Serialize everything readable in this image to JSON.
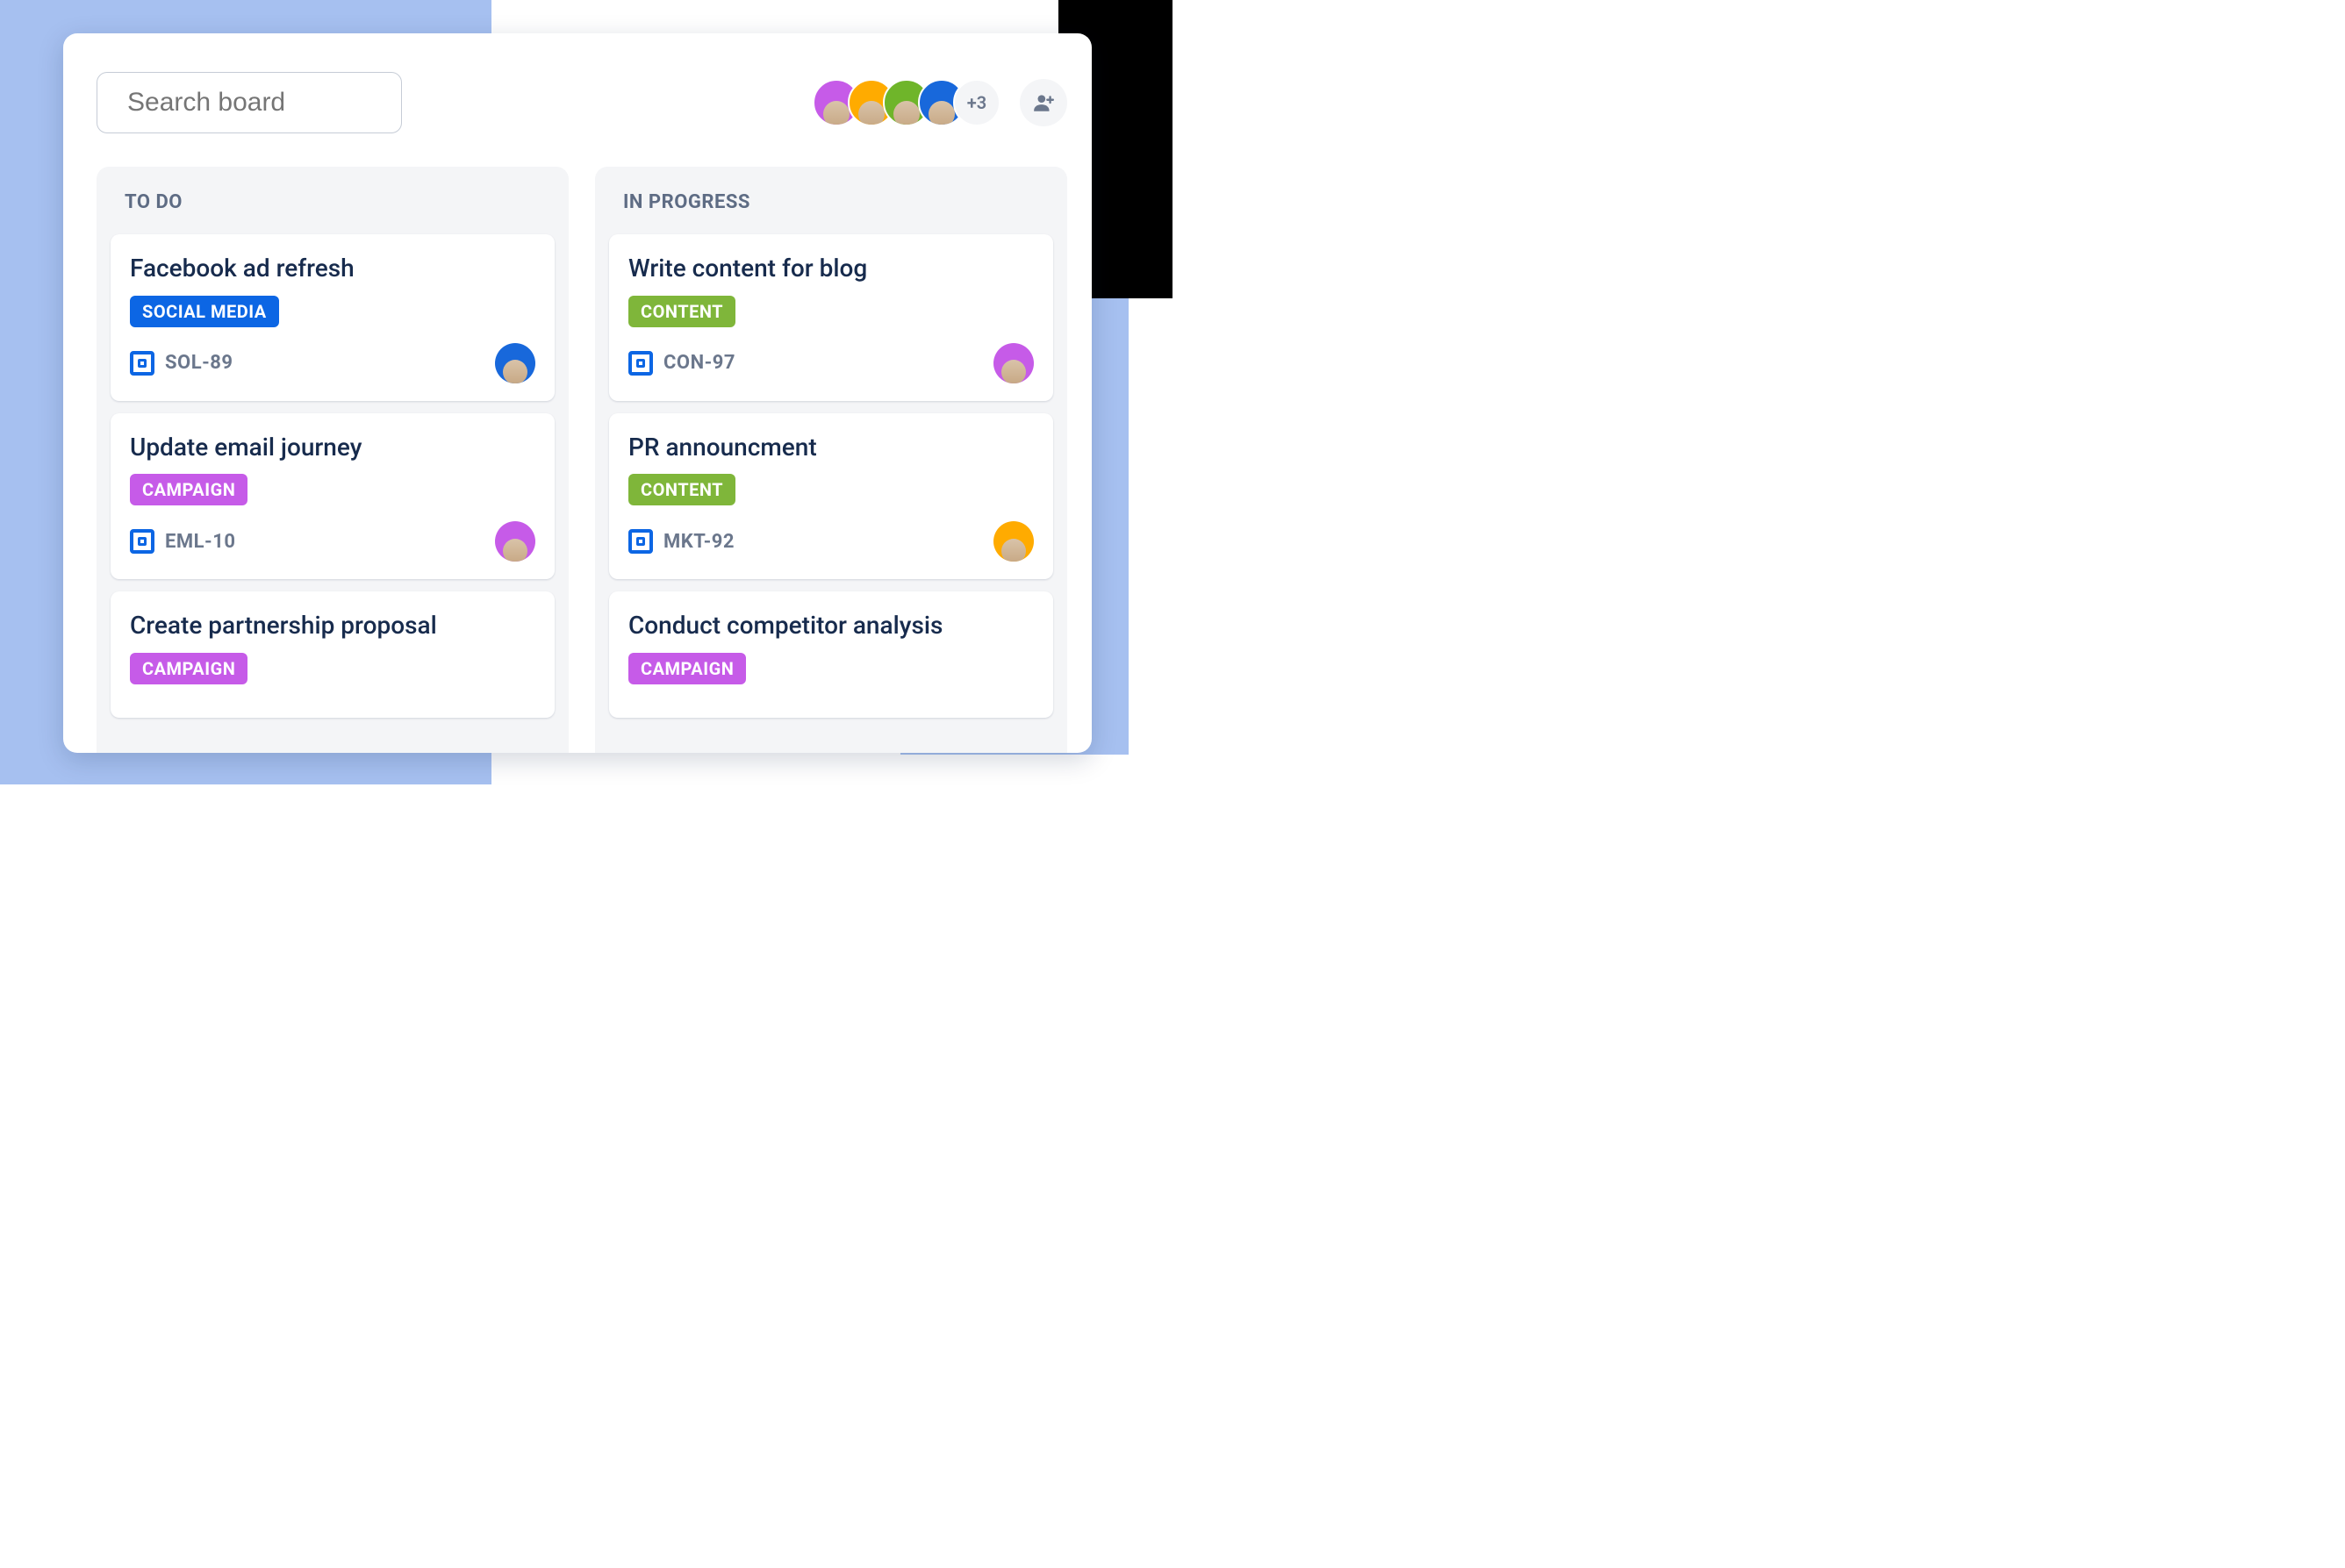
{
  "search": {
    "placeholder": "Search board"
  },
  "avatars": {
    "members": [
      {
        "bg": "#C65BE8"
      },
      {
        "bg": "#FFAB00"
      },
      {
        "bg": "#6FB52A"
      },
      {
        "bg": "#1868DB"
      }
    ],
    "more_label": "+3"
  },
  "tag_colors": {
    "SOCIAL MEDIA": "tag-blue",
    "CAMPAIGN": "tag-purple",
    "CONTENT": "tag-green"
  },
  "assignee_colors": {
    "blue": "#1868DB",
    "purple": "#C65BE8",
    "orange": "#FFAB00"
  },
  "columns": [
    {
      "title": "TO DO",
      "cards": [
        {
          "title": "Facebook ad refresh",
          "tag": "SOCIAL MEDIA",
          "id": "SOL-89",
          "assignee": "blue"
        },
        {
          "title": "Update email journey",
          "tag": "CAMPAIGN",
          "id": "EML-10",
          "assignee": "purple"
        },
        {
          "title": "Create partnership proposal",
          "tag": "CAMPAIGN",
          "id": "",
          "assignee": ""
        }
      ]
    },
    {
      "title": "IN PROGRESS",
      "cards": [
        {
          "title": "Write content for blog",
          "tag": "CONTENT",
          "id": "CON-97",
          "assignee": "purple"
        },
        {
          "title": "PR announcment",
          "tag": "CONTENT",
          "id": "MKT-92",
          "assignee": "orange"
        },
        {
          "title": "Conduct competitor analysis",
          "tag": "CAMPAIGN",
          "id": "",
          "assignee": ""
        }
      ]
    }
  ]
}
